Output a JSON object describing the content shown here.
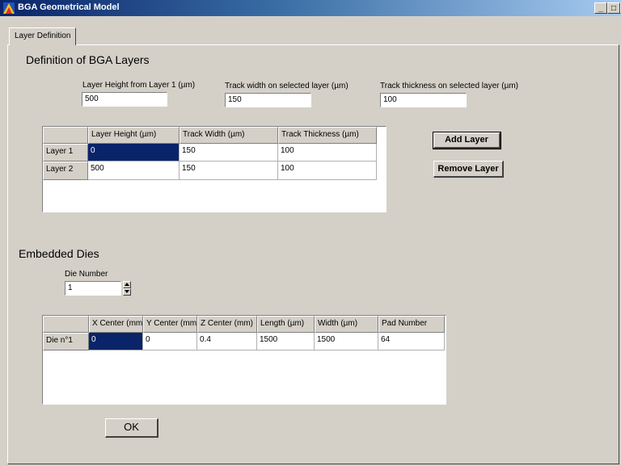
{
  "window": {
    "title": "BGA Geometrical Model",
    "minimize_glyph": "_",
    "maximize_glyph": "□",
    "close_glyph": "x"
  },
  "tab": {
    "label": "Layer Definition"
  },
  "layers": {
    "heading": "Definition of BGA Layers",
    "height_label": "Layer Height from Layer 1 (µm)",
    "height_value": "500",
    "width_label": "Track width on selected layer (µm)",
    "width_value": "150",
    "thickness_label": "Track thickness on selected layer (µm)",
    "thickness_value": "100",
    "columns": [
      "Layer Height (µm)",
      "Track Width (µm)",
      "Track Thickness (µm)"
    ],
    "rows": [
      {
        "header": "Layer 1",
        "cells": [
          "0",
          "150",
          "100"
        ]
      },
      {
        "header": "Layer 2",
        "cells": [
          "500",
          "150",
          "100"
        ]
      }
    ],
    "add_button": "Add Layer",
    "remove_button": "Remove Layer"
  },
  "dies": {
    "heading": "Embedded Dies",
    "number_label": "Die Number",
    "number_value": "1",
    "columns": [
      "X Center (mm)",
      "Y Center (mm)",
      "Z Center (mm)",
      "Length (µm)",
      "Width (µm)",
      "Pad Number"
    ],
    "rows": [
      {
        "header": "Die n°1",
        "cells": [
          "0",
          "0",
          "0.4",
          "1500",
          "1500",
          "64"
        ]
      }
    ]
  },
  "ok_button": "OK"
}
